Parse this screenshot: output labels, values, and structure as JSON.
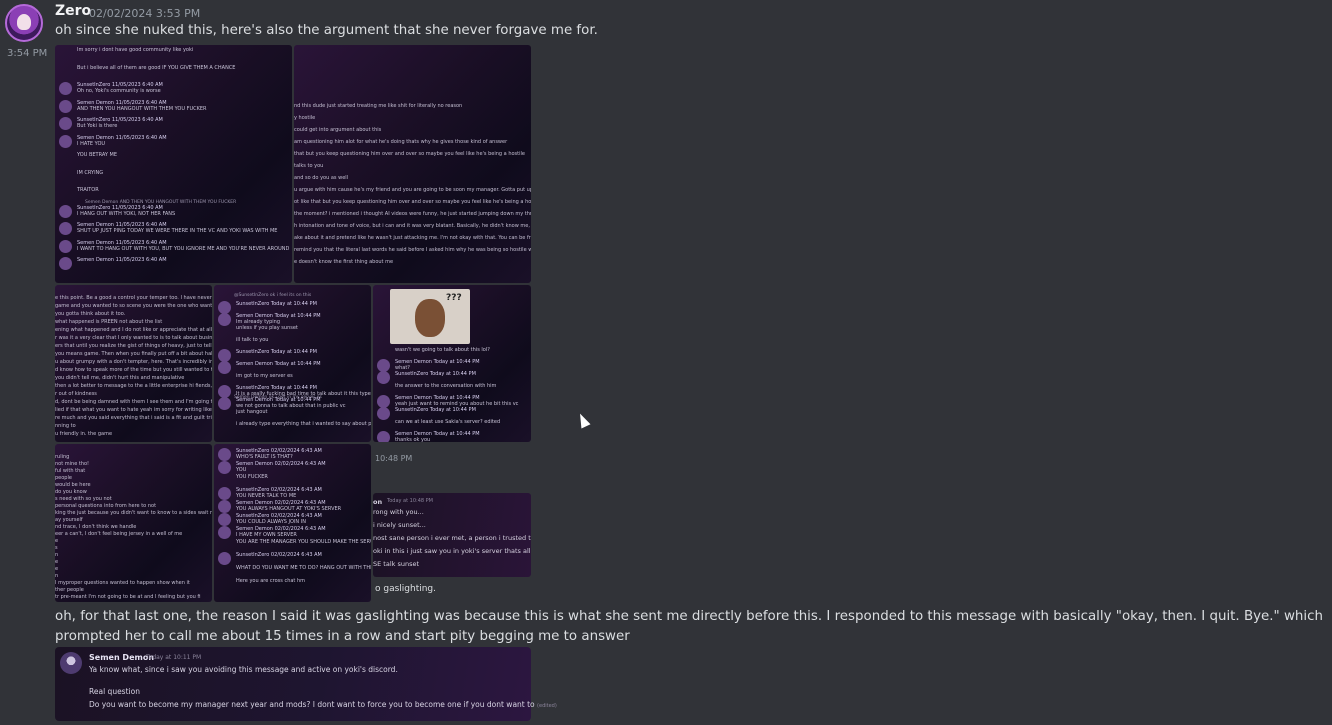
{
  "author": {
    "name": "Zero",
    "timestamp": "02/02/2024 3:53 PM"
  },
  "message1": {
    "text": "oh since she nuked this, here's also the argument that she never forgave me for."
  },
  "side_time": "3:54 PM",
  "grid": {
    "tl": {
      "rows": [
        {
          "name": "",
          "line": "Im sorry i dont have good community like yoki"
        },
        {
          "name": "",
          "line": "But i believe all of them are good IF YOU GIVE THEM A CHANCE"
        },
        {
          "name": "SunsetInZero  11/05/2023 6:40 AM",
          "line": "Oh no, Yoki's community is worse"
        },
        {
          "name": "Semen Demon  11/05/2023 6:40 AM",
          "line": "AND THEN YOU HANGOUT WITH THEM YOU FUCKER"
        },
        {
          "name": "SunsetInZero  11/05/2023 6:40 AM",
          "line": "But Yoki is there"
        },
        {
          "name": "Semen Demon  11/05/2023 6:40 AM",
          "line": "I HATE YOU"
        },
        {
          "name": "",
          "line": "YOU BETRAY ME"
        },
        {
          "name": "",
          "line": "IM CRYING"
        },
        {
          "name": "",
          "line": "TRAITOR"
        },
        {
          "name": "SunsetInZero  11/05/2023 6:40 AM",
          "line": "I HANG OUT WITH YOKI, NOT HER FANS"
        },
        {
          "name": "Semen Demon  11/05/2023 6:40 AM",
          "line": "SHUT UP JUST PING TODAY WE WERE THERE IN THE VC AND YOKI WAS WITH ME"
        },
        {
          "name": "Semen Demon  11/05/2023 6:40 AM",
          "line": "I WANT TO HANG OUT WITH YOU, BUT YOU IGNORE ME AND YOU'RE NEVER AROUND"
        },
        {
          "name": "Semen Demon  11/05/2023 6:40 AM",
          "line": ""
        }
      ],
      "reply": "Semen Demon  AND THEN YOU HANGOUT WITH THEM YOU FUCKER"
    },
    "tr": {
      "lines": [
        "nd this dude just started treating me like shit for literally no reason",
        "y hostile",
        "could get into argument about this",
        "am questioning him alot for what he's doing thats why he gives those kind of answer",
        "that but you keep questioning him over and over so maybe you feel like he's being a hostile",
        "talks to you",
        "and so do you as well",
        "u argue with him cause he's my friend and you are going to be soon my manager. Gotta put up a good image so im",
        "ot like that but you keep questioning him over and over so maybe you feel like he's being a hostile",
        "the moment? i mentioned i thought AI videos were funny, he just started jumping down my throat, being condescen",
        "h intonation and tone of voice, but i can and it was very blatant. Basically, he didn't know me, I said something he d",
        "ake about it and pretend like he wasn't just attacking me. I'm not okay with that. You can be friends with whoever y",
        "remind you that the literal last words he said before I asked him why he was being so hostile were \"i guess I should",
        "e doesn't know the first thing about me"
      ]
    },
    "ml": {
      "lines": [
        "e this point. Be a good a control your temper too. I have never once joined the fray, perhaps if he does. W",
        "game and you wanted to so scene you were the one who wanted to talk about the topic but, i suggest",
        "you gotta think about it too.",
        "what happened is PREEN not about the list",
        "ening what happened and I do not like or appreciate that at all.",
        "r was it a very clear that I only wanted to is to talk about business stuff because you want me want to",
        "ers that until you realize the gist of things of heavy, just to tell to you, you showed up to Sakia's server",
        "you means game. Then when you finally put off a bit about half an hour later and when per wanted to read",
        "u about grumpy with a don't tempter, here. That's incredibly insulting",
        "d know how to speak more of the time but you still wanted to talk up",
        "you didn't tell me, didn't hurt this and manipulative",
        "then a lot better to message to the a little enterprise hi fiends, and I'm going about, still talk to you, ou",
        "r out of kindness",
        "d, dont be being damned with them I see them and I'm going to talk to you",
        "lied if that what you want to hate yeah im sorry for writing like it can I know that i realized that but you can",
        "re much and you said everything that i said is a fit and guilt tripping",
        "nning to",
        "u friendly in. the game"
      ]
    },
    "mm": {
      "rows": [
        {
          "name": "SunsetInZero  Today at 10:44 PM",
          "line": ""
        },
        {
          "name": "Semen Demon  Today at 10:44 PM",
          "line": "Im already typing"
        },
        {
          "name": "",
          "line": "unless if you play sunset"
        },
        {
          "name": "",
          "line": "ill talk to you"
        },
        {
          "name": "SunsetInZero  Today at 10:44 PM",
          "line": ""
        },
        {
          "name": "Semen Demon  Today at 10:44 PM",
          "line": ""
        },
        {
          "name": "",
          "line": "im got to my server es"
        },
        {
          "name": "SunsetInZero  Today at 10:44 PM",
          "line": "It is a really fucking bad time to talk about it this type of thing in your PUBLIC VC"
        },
        {
          "name": "Semen Demon  Today at 10:44 PM",
          "line": "we not gonna to talk about that in public vc"
        },
        {
          "name": "",
          "line": "just hangout"
        },
        {
          "name": "",
          "line": "i already type everything that i wanted to say about prism"
        }
      ],
      "reply_top": "@SunsetInZero  ok i feel its on this",
      "reply_mid": "Semen Demon  ok i get in my server es"
    },
    "mr": {
      "meme_text": "???",
      "rows": [
        {
          "name": "",
          "line": "wasn't we going to talk about this lol?"
        },
        {
          "name": "Semen Demon  Today at 10:44 PM",
          "line": "what?"
        },
        {
          "name": "SunsetInZero  Today at 10:44 PM",
          "line": ""
        },
        {
          "name": "",
          "line": "the answer to the conversation with him"
        },
        {
          "name": "Semen Demon  Today at 10:44 PM",
          "line": "yeah just want to remind you about he bit this vc"
        },
        {
          "name": "SunsetInZero  Today at 10:44 PM",
          "line": ""
        },
        {
          "name": "",
          "line": "can we at least use Sakia's server? edited"
        },
        {
          "name": "Semen Demon  Today at 10:44 PM",
          "line": "thanks ok you"
        }
      ]
    },
    "bl": {
      "lines": [
        "ruling",
        "not mine tho!",
        "ful with that",
        "people",
        "would be here",
        "do you know",
        "s need with so you not",
        "personal questions into from here to not",
        "king the just because you didn't want to know to a sides wait note my pair",
        "ay yourself",
        "nd trace, I don't think we handle",
        "eer a can't, I don't feel being jersey in a well of me",
        "e",
        "s",
        "n",
        "e",
        "e",
        "n",
        "I myproper questions wanted to happen show when it",
        "ther people",
        "tr pre-meant I'm not going to be at and I feeling but you fi"
      ]
    },
    "bm": {
      "rows": [
        {
          "name": "SunsetInZero  02/02/2024 6:43 AM",
          "line": "WHO'S FAULT IS THAT?"
        },
        {
          "name": "Semen Demon  02/02/2024 6:43 AM",
          "line": "YOU"
        },
        {
          "name": "",
          "line": "YOU FUCKER"
        },
        {
          "name": "SunsetInZero  02/02/2024 6:43 AM",
          "line": "YOU NEVER TALK TO ME"
        },
        {
          "name": "Semen Demon  02/02/2024 6:43 AM",
          "line": "YOU ALWAYS HANGOUT AT YOKI'S SERVER"
        },
        {
          "name": "SunsetInZero  02/02/2024 6:43 AM",
          "line": "YOU COULD ALWAYS JOIN IN"
        },
        {
          "name": "Semen Demon  02/02/2024 6:43 AM",
          "line": "I HAVE MY OWN SERVER"
        },
        {
          "name": "",
          "line": "YOU ARE THE MANAGER YOU SHOULD MAKE THE SERVER FEEL ALIVE YOU FUCKER"
        },
        {
          "name": "SunsetInZero  02/02/2024 6:43 AM",
          "line": ""
        },
        {
          "name": "",
          "line": "WHAT DO YOU WANT ME TO DO? HANG OUT WITH THE COMMUNITY WHILE YOU'RE AWAY?"
        },
        {
          "name": "",
          "line": "Here you are cross chat hm"
        }
      ]
    },
    "br": {
      "time": "10:48 PM",
      "header_name": "on",
      "header_time": "Today at 10:48 PM",
      "lines": [
        "rong with you...",
        "i nicely sunset...",
        "nost sane person i ever met, a person i trusted the m",
        "oki in this i just saw you in yoki's server thats all",
        "SE talk sunset"
      ],
      "caption": "o gaslighting."
    }
  },
  "message2": {
    "text": "oh, for that last one, the reason I said it was gaslighting was because this is what she sent me directly before this. I responded to this message with basically \"okay, then. I quit. Bye.\" which prompted her to call me about 15 times in a row and start pity begging me to answer"
  },
  "embed": {
    "name": "Semen Demon",
    "time": "Today at 10:11 PM",
    "line1": "Ya know what, since i saw you avoiding this message and active on yoki's discord.",
    "line2": "Real question",
    "line3": "Do you want to become my manager next year and mods? I dont want to force you to become one if you dont want to",
    "edited": "(edited)"
  }
}
